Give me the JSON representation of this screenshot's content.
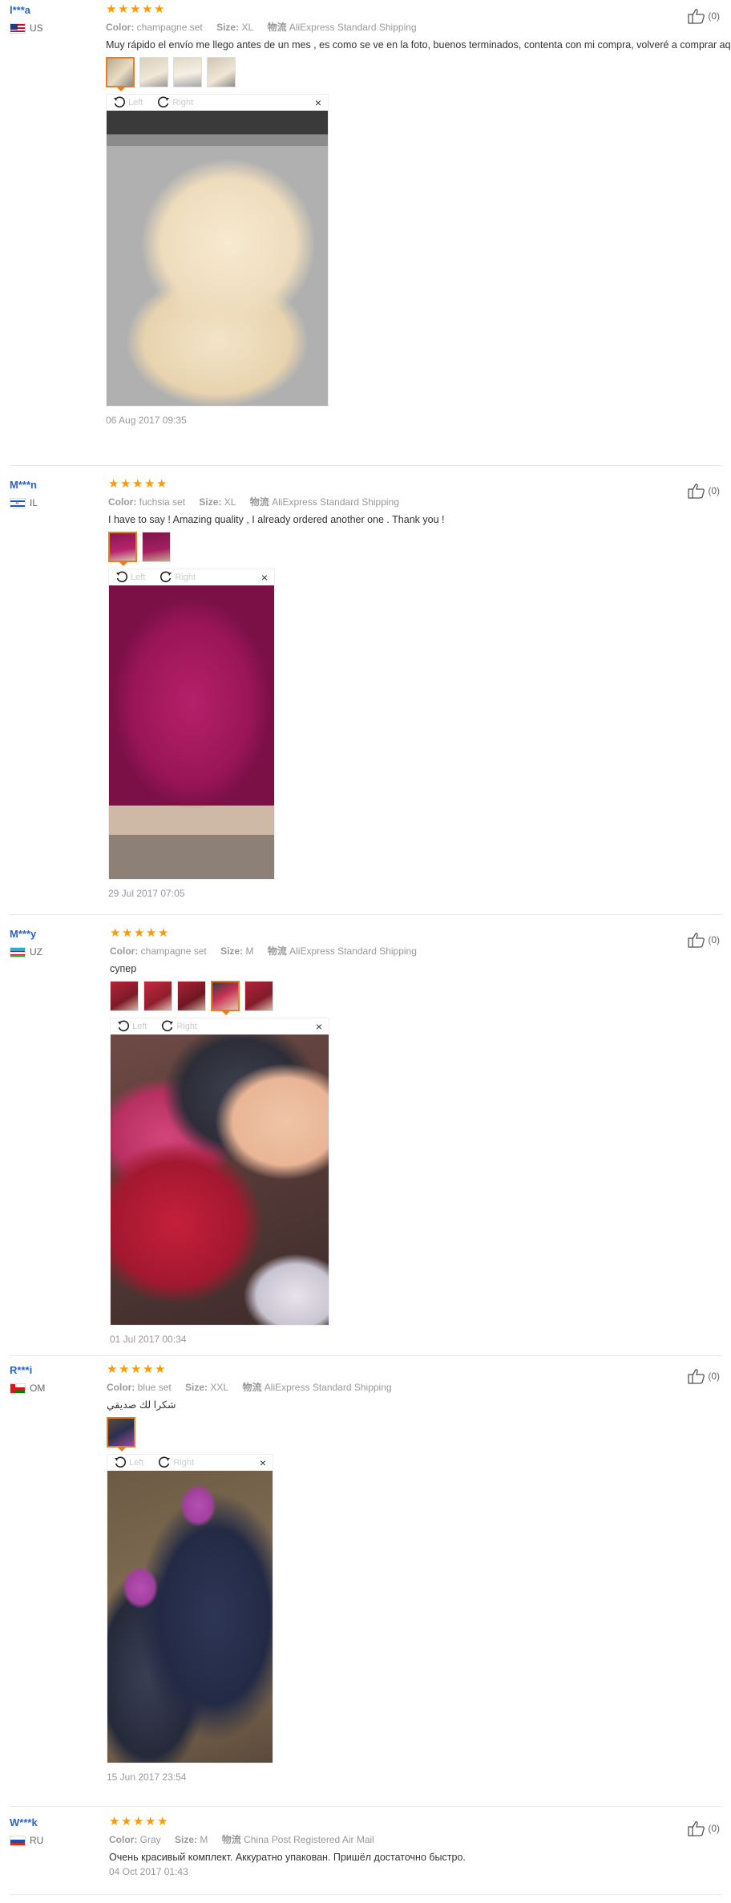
{
  "labels": {
    "color": "Color:",
    "size": "Size:",
    "shipping": "物流",
    "rotate_left": "Left",
    "rotate_right": "Right",
    "close": "×"
  },
  "reviews": [
    {
      "user": "l***a",
      "country": "US",
      "flag": "us",
      "color": "champagne set",
      "size": "XL",
      "shipping": "AliExpress Standard Shipping",
      "text": "Muy rápido el envío me llego antes de un mes , es como se ve en la foto, buenos terminados, contenta con mi compra, volveré a comprar aqui",
      "date": "06 Aug 2017 09:35",
      "likes": "(0)"
    },
    {
      "user": "M***n",
      "country": "IL",
      "flag": "il",
      "color": "fuchsia set",
      "size": "XL",
      "shipping": "AliExpress Standard Shipping",
      "text": "I have to say ! Amazing quality , I already ordered another one . Thank you !",
      "date": "29 Jul 2017 07:05",
      "likes": "(0)"
    },
    {
      "user": "M***y",
      "country": "UZ",
      "flag": "uz",
      "color": "champagne set",
      "size": "M",
      "shipping": "AliExpress Standard Shipping",
      "text": "супер",
      "date": "01 Jul 2017 00:34",
      "likes": "(0)"
    },
    {
      "user": "R***i",
      "country": "OM",
      "flag": "om",
      "color": "blue set",
      "size": "XXL",
      "shipping": "AliExpress Standard Shipping",
      "text": "شكرا لك صديقي",
      "date": "15 Jun 2017 23:54",
      "likes": "(0)"
    },
    {
      "user": "W***k",
      "country": "RU",
      "flag": "ru",
      "color": "Gray",
      "size": "M",
      "shipping": "China Post Registered Air Mail",
      "text": "Очень красивый комплект. Аккуратно упакован. Пришёл достаточно быстро.",
      "date": "04 Oct 2017 01:43",
      "likes": "(0)"
    }
  ],
  "colors": {
    "star": "#ff9900",
    "username": "#2a64c5",
    "active_thumb": "#e67e22"
  }
}
